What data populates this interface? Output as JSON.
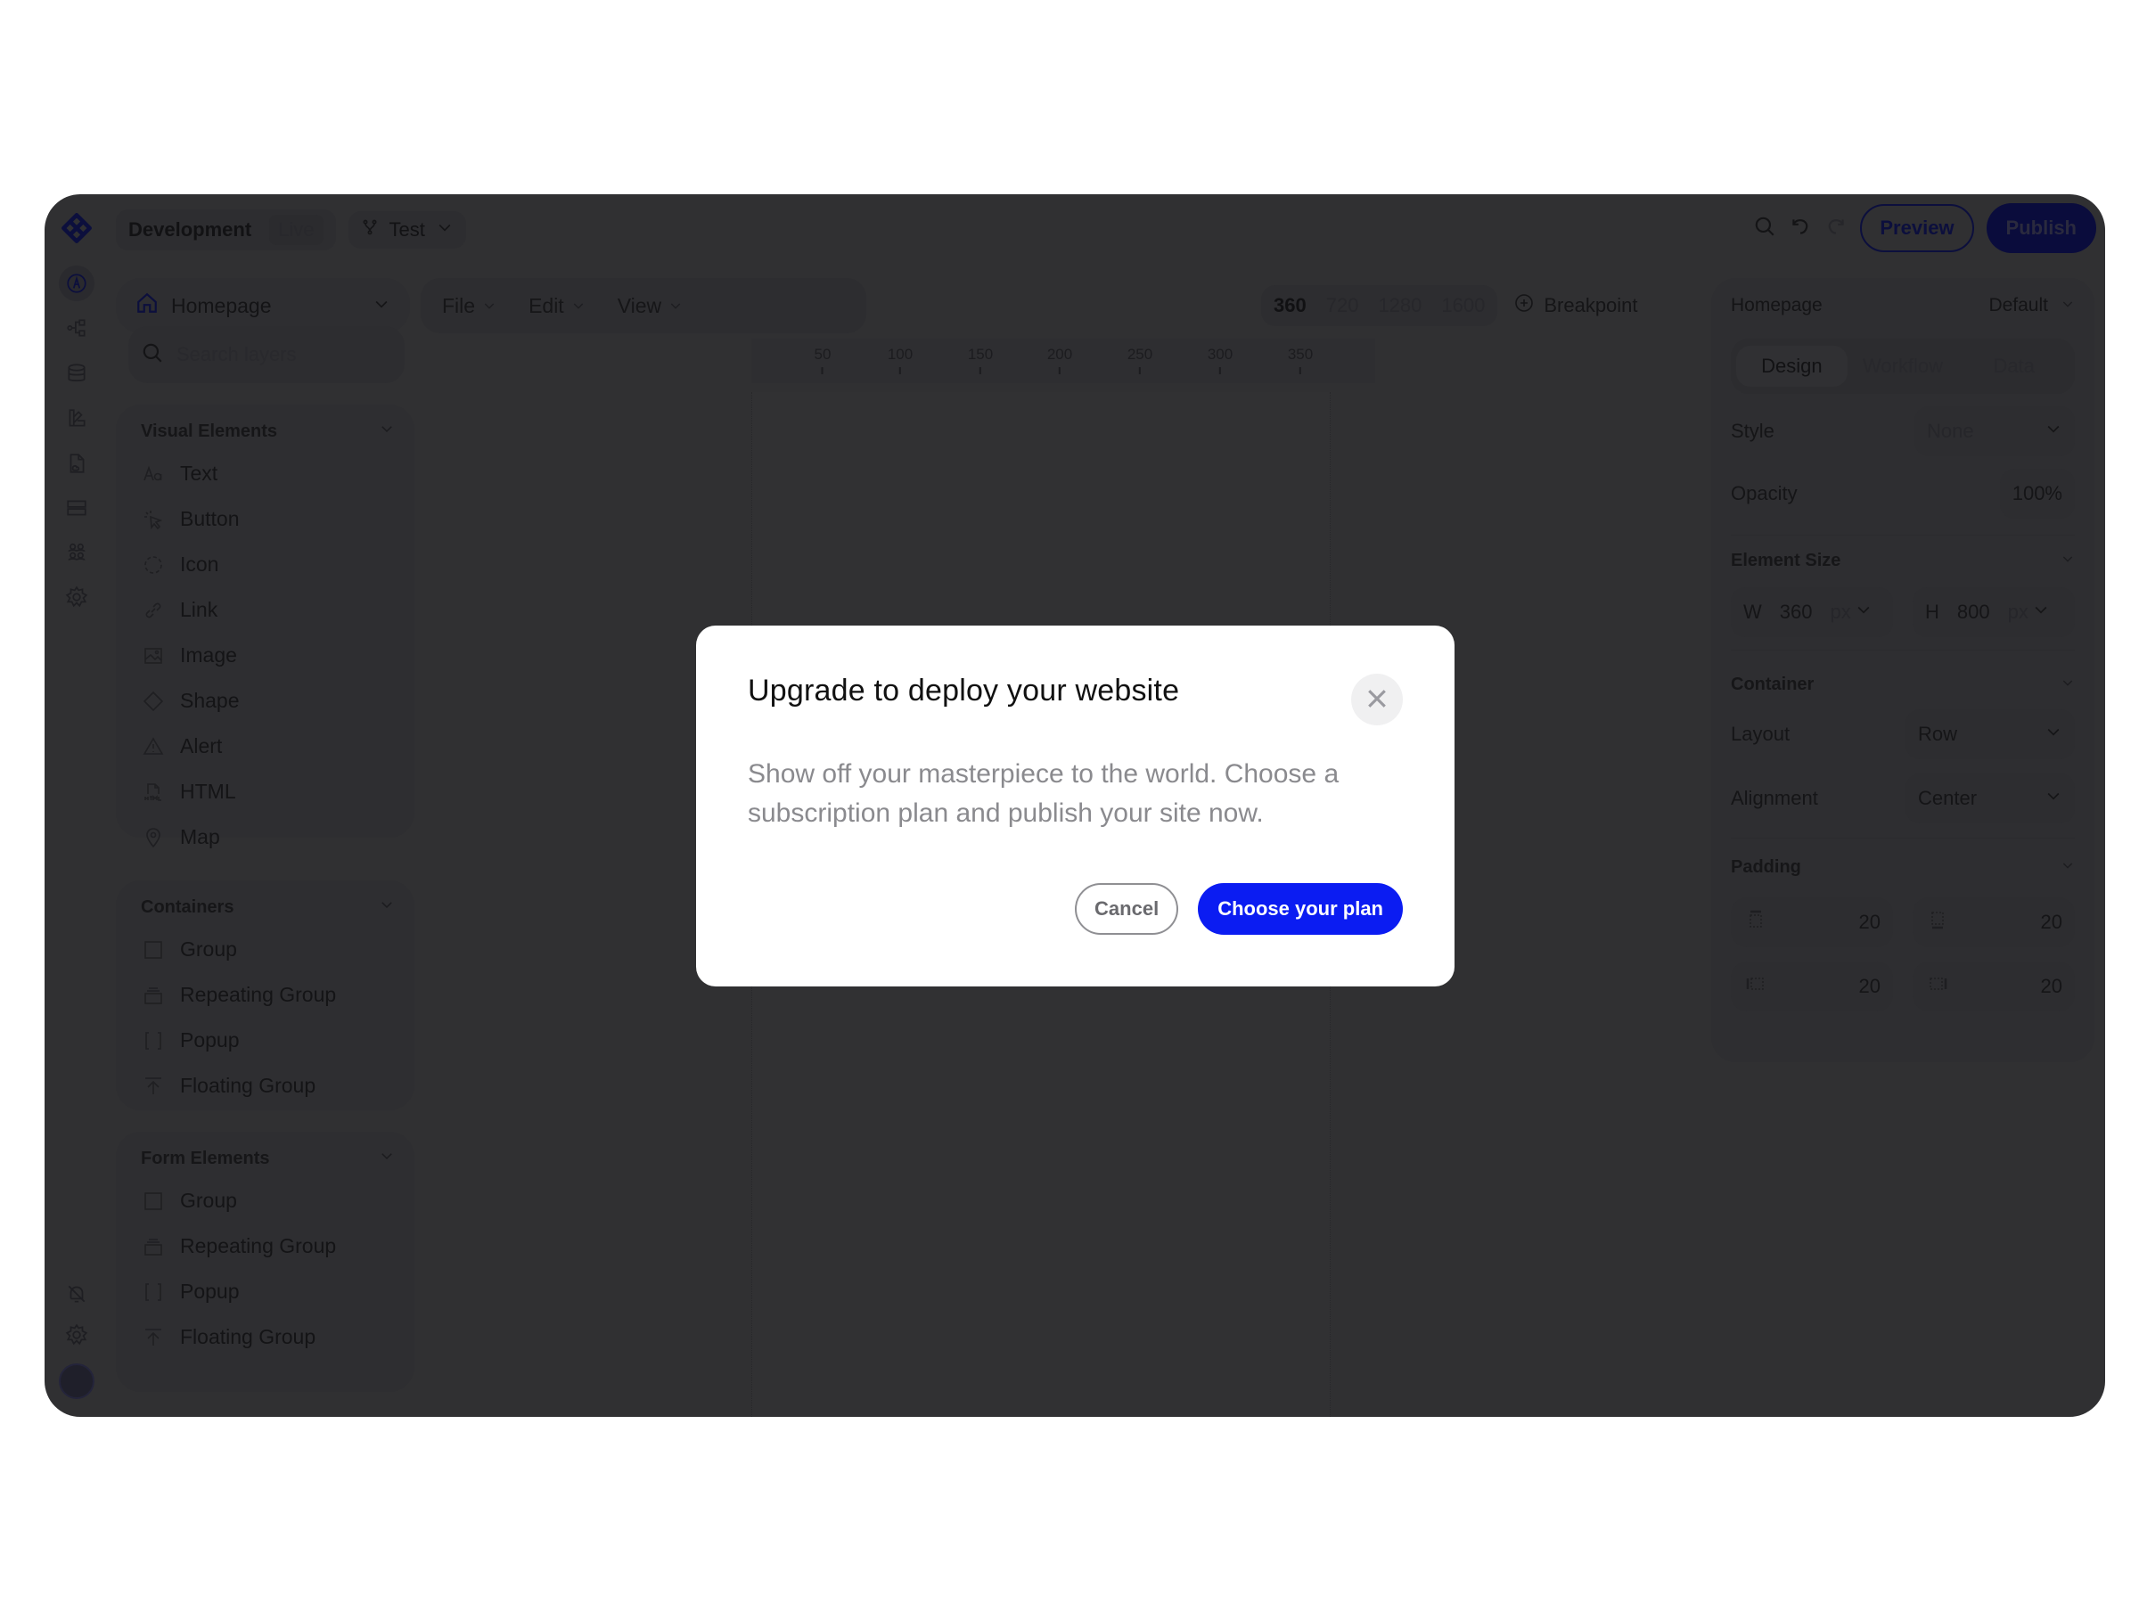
{
  "topbar": {
    "environment": "Development",
    "environment_alt": "Live",
    "branch": "Test",
    "preview_label": "Preview",
    "publish_label": "Publish"
  },
  "left_panel": {
    "page_selector": "Homepage",
    "search_placeholder": "Search layers",
    "sections": [
      {
        "title": "Visual Elements",
        "items": [
          {
            "label": "Text",
            "icon": "text-aa-icon"
          },
          {
            "label": "Button",
            "icon": "cursor-click-icon"
          },
          {
            "label": "Icon",
            "icon": "dashed-circle-icon"
          },
          {
            "label": "Link",
            "icon": "link-icon"
          },
          {
            "label": "Image",
            "icon": "image-icon"
          },
          {
            "label": "Shape",
            "icon": "diamond-icon"
          },
          {
            "label": "Alert",
            "icon": "warning-triangle-icon"
          },
          {
            "label": "HTML",
            "icon": "html-file-icon"
          },
          {
            "label": "Map",
            "icon": "map-pin-icon"
          }
        ]
      },
      {
        "title": "Containers",
        "items": [
          {
            "label": "Group",
            "icon": "square-icon"
          },
          {
            "label": "Repeating Group",
            "icon": "stack-icon"
          },
          {
            "label": "Popup",
            "icon": "brackets-icon"
          },
          {
            "label": "Floating Group",
            "icon": "arrow-up-bar-icon"
          }
        ]
      },
      {
        "title": "Form Elements",
        "items": [
          {
            "label": "Group",
            "icon": "square-icon"
          },
          {
            "label": "Repeating Group",
            "icon": "stack-icon"
          },
          {
            "label": "Popup",
            "icon": "brackets-icon"
          },
          {
            "label": "Floating Group",
            "icon": "arrow-up-bar-icon"
          }
        ]
      }
    ]
  },
  "toolbar": {
    "menus": [
      "File",
      "Edit",
      "View"
    ],
    "breakpoints": [
      "360",
      "720",
      "1280",
      "1600"
    ],
    "active_breakpoint": "360",
    "add_breakpoint_label": "Breakpoint"
  },
  "ruler": {
    "ticks": [
      "50",
      "100",
      "150",
      "200",
      "250",
      "300",
      "350"
    ]
  },
  "right_panel": {
    "page": "Homepage",
    "state": "Default",
    "tabs": [
      "Design",
      "Workflow",
      "Data"
    ],
    "active_tab": "Design",
    "style_label": "Style",
    "style_value": "None",
    "opacity_label": "Opacity",
    "opacity_value": "100%",
    "element_size_title": "Element Size",
    "width_label": "W",
    "width_value": "360",
    "width_unit": "px",
    "height_label": "H",
    "height_value": "800",
    "height_unit": "px",
    "container_title": "Container",
    "layout_label": "Layout",
    "layout_value": "Row",
    "alignment_label": "Alignment",
    "alignment_value": "Center",
    "padding_title": "Padding",
    "padding": {
      "top": "20",
      "bottom": "20",
      "left": "20",
      "right": "20"
    }
  },
  "modal": {
    "title": "Upgrade to deploy your website",
    "body": "Show off your masterpiece to the world. Choose a subscription plan and publish your site now.",
    "cancel_label": "Cancel",
    "confirm_label": "Choose your plan",
    "accent_color": "#0b1cf2"
  }
}
